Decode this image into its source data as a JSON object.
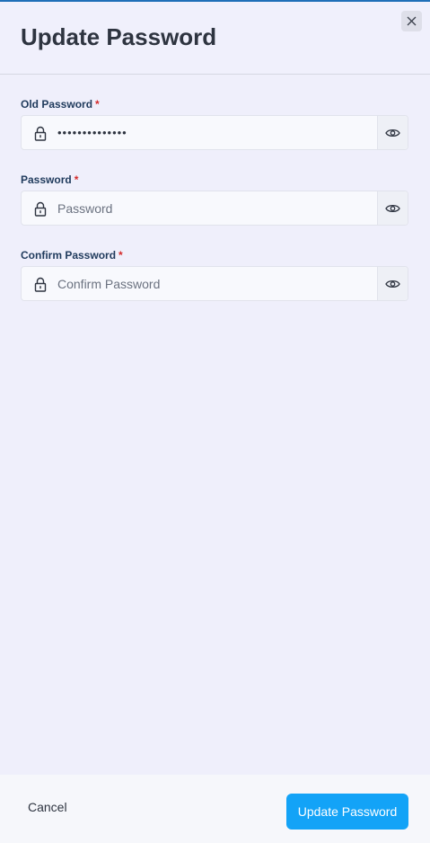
{
  "dialog": {
    "title": "Update Password",
    "close_icon": "close-icon"
  },
  "fields": [
    {
      "label": "Old Password",
      "required_mark": "*",
      "value": "••••••••••••••",
      "placeholder": "",
      "icon": "lock-icon",
      "toggle_icon": "eye-icon"
    },
    {
      "label": "Password",
      "required_mark": "*",
      "value": "",
      "placeholder": "Password",
      "icon": "lock-icon",
      "toggle_icon": "eye-icon"
    },
    {
      "label": "Confirm Password",
      "required_mark": "*",
      "value": "",
      "placeholder": "Confirm Password",
      "icon": "lock-icon",
      "toggle_icon": "eye-icon"
    }
  ],
  "footer": {
    "cancel_label": "Cancel",
    "submit_label": "Update Password"
  },
  "colors": {
    "accent": "#13a3f7",
    "required": "#d42a2a",
    "background": "#efeffb"
  }
}
